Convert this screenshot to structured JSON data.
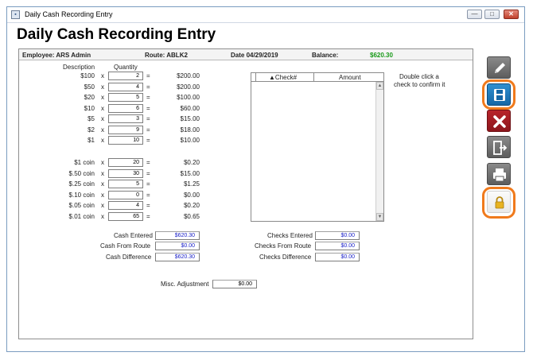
{
  "window": {
    "title": "Daily Cash Recording Entry",
    "buttons": {
      "minimize": "—",
      "maximize": "□",
      "close": "✕"
    }
  },
  "heading": "Daily Cash Recording Entry",
  "info": {
    "employee": "Employee: ARS Admin",
    "route": "Route: ABLK2",
    "date": "Date  04/29/2019",
    "balance_label": "Balance:",
    "balance_value": "$620.30",
    "balance_color": "#1a9a1a"
  },
  "cash": {
    "description_header": "Description",
    "quantity_header": "Quantity",
    "multiply": "x",
    "equals": "=",
    "bills": [
      {
        "label": "$100",
        "qty": "2",
        "amount": "$200.00"
      },
      {
        "label": "$50",
        "qty": "4",
        "amount": "$200.00"
      },
      {
        "label": "$20",
        "qty": "5",
        "amount": "$100.00"
      },
      {
        "label": "$10",
        "qty": "6",
        "amount": "$60.00"
      },
      {
        "label": "$5",
        "qty": "3",
        "amount": "$15.00"
      },
      {
        "label": "$2",
        "qty": "9",
        "amount": "$18.00"
      },
      {
        "label": "$1",
        "qty": "10",
        "amount": "$10.00"
      }
    ],
    "coins": [
      {
        "label": "$1 coin",
        "qty": "20",
        "amount": "$0.20"
      },
      {
        "label": "$.50 coin",
        "qty": "30",
        "amount": "$15.00"
      },
      {
        "label": "$.25 coin",
        "qty": "5",
        "amount": "$1.25"
      },
      {
        "label": "$.10 coin",
        "qty": "0",
        "amount": "$0.00"
      },
      {
        "label": "$.05 coin",
        "qty": "4",
        "amount": "$0.20"
      },
      {
        "label": "$.01 coin",
        "qty": "65",
        "amount": "$0.65"
      }
    ],
    "cash_entered_label": "Cash Entered",
    "cash_entered_value": "$620.30",
    "cash_from_route_label": "Cash From Route",
    "cash_from_route_value": "$0.00",
    "cash_difference_label": "Cash Difference",
    "cash_difference_value": "$620.30",
    "misc_label": "Misc. Adjustment",
    "misc_value": "$0.00"
  },
  "checks": {
    "col_check": "▲Check#",
    "col_amount": "Amount",
    "hint_line1": "Double click a",
    "hint_line2": "check to confirm it",
    "checks_entered_label": "Checks Entered",
    "checks_entered_value": "$0.00",
    "checks_from_route_label": "Checks From Route",
    "checks_from_route_value": "$0.00",
    "checks_difference_label": "Checks Difference",
    "checks_difference_value": "$0.00",
    "scroll_up": "▲",
    "scroll_down": "▼"
  },
  "toolbar": {
    "edit_icon": "pencil-icon",
    "save_icon": "floppy-disk-icon",
    "delete_icon": "x-icon",
    "exit_icon": "exit-door-icon",
    "print_icon": "printer-icon",
    "lock_icon": "padlock-icon"
  }
}
